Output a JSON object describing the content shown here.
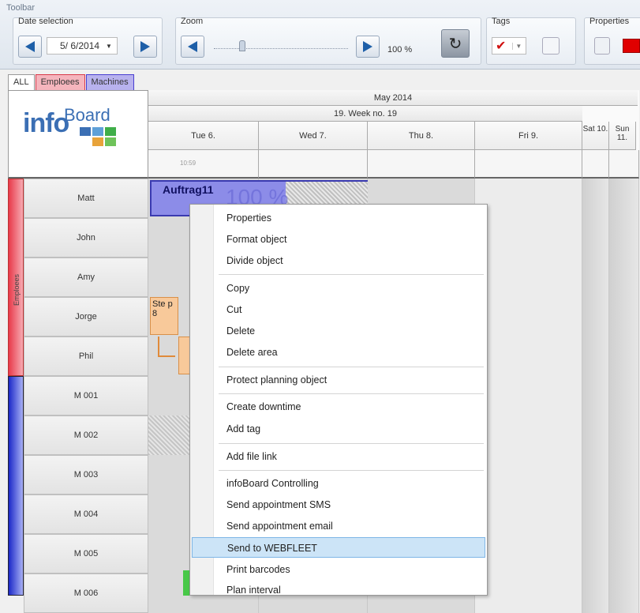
{
  "toolbar": {
    "title": "Toolbar",
    "date_selection": {
      "label": "Date selection",
      "value": "5/ 6/2014"
    },
    "zoom": {
      "label": "Zoom",
      "value": "100 %"
    },
    "tags": {
      "label": "Tags"
    },
    "properties": {
      "label": "Properties"
    }
  },
  "tabs": [
    {
      "label": "ALL"
    },
    {
      "label": "Emploees"
    },
    {
      "label": "Machines"
    }
  ],
  "logo": {
    "info": "info",
    "board": "Board"
  },
  "calendar": {
    "month": "May 2014",
    "week": "19. Week no. 19",
    "days": [
      "Tue 6.",
      "Wed 7.",
      "Thu 8.",
      "Fri 9.",
      "Sat 10.",
      "Sun 11."
    ],
    "time_marker": "10:59"
  },
  "groups": {
    "employees": "Emploees"
  },
  "rows": [
    "Matt",
    "John",
    "Amy",
    "Jorge",
    "Phil",
    "M 001",
    "M 002",
    "M 003",
    "M 004",
    "M 005",
    "M 006"
  ],
  "tasks": {
    "main_title": "Auftrag11",
    "main_pct": "100 %",
    "step": "Ste p 8"
  },
  "context_menu": {
    "items": [
      "Properties",
      "Format object",
      "Divide object",
      "Copy",
      "Cut",
      "Delete",
      "Delete area",
      "Protect planning object",
      "Create downtime",
      "Add tag",
      "Add file link",
      "infoBoard Controlling",
      "Send appointment SMS",
      "Send appointment email",
      "Send to WEBFLEET",
      "Print barcodes",
      "Plan interval"
    ],
    "highlighted": "Send to WEBFLEET"
  },
  "colors": {
    "employees": "#e83a4a",
    "machines": "#1a28c8",
    "task": "#8c8ce8",
    "highlight": "#cce4f7"
  }
}
